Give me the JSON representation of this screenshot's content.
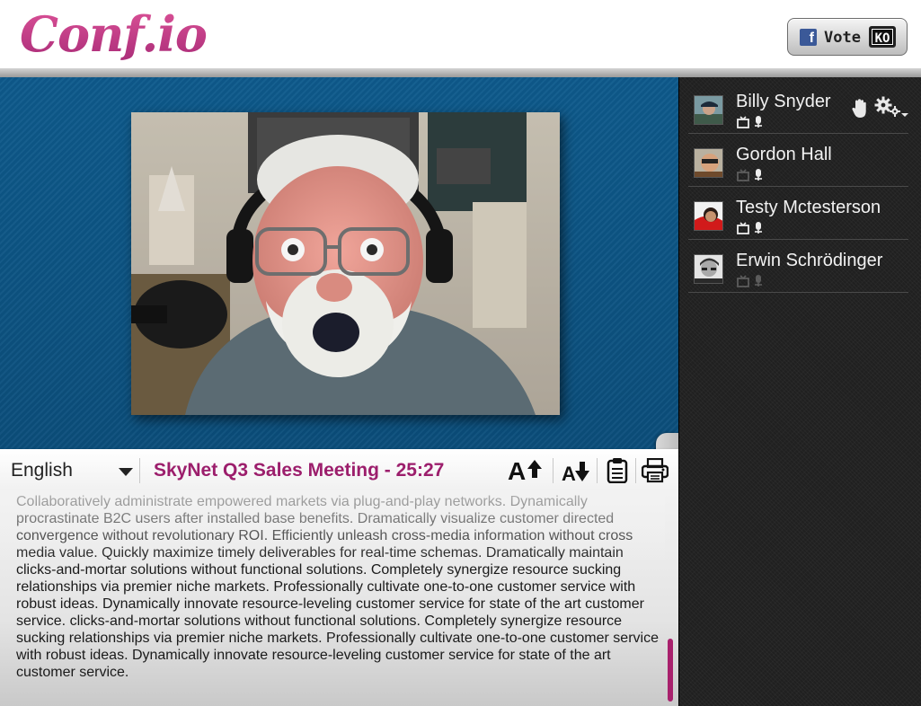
{
  "header": {
    "logo_text": "Conf.io",
    "vote_button": {
      "brand_icon": "facebook-icon",
      "label": "Vote",
      "badge": "KO"
    }
  },
  "video": {
    "collapse_icon": "chevron-right-icon"
  },
  "toolbar": {
    "language": "English",
    "meeting_title": "SkyNet Q3 Sales Meeting - 25:27",
    "icons": [
      "increase-font-icon",
      "decrease-font-icon",
      "clipboard-icon",
      "print-icon"
    ]
  },
  "transcript": {
    "text": "Collaboratively administrate empowered markets via plug-and-play networks. Dynamically procrastinate B2C users after installed base benefits. Dramatically visualize customer directed convergence without revolutionary ROI. Efficiently unleash cross-media information without cross media value. Quickly maximize timely deliverables for real-time schemas. Dramatically maintain clicks-and-mortar solutions without functional solutions. Completely synergize resource sucking relationships via premier niche markets. Professionally cultivate one-to-one customer service with robust ideas. Dynamically innovate resource-leveling customer service for state of the art customer service. clicks-and-mortar solutions without functional solutions. Completely synergize resource sucking relationships via premier niche markets. Professionally cultivate one-to-one customer service with robust ideas. Dynamically innovate resource-leveling customer service for state of the art customer service.",
    "accent_color": "#a8206c"
  },
  "participants": [
    {
      "name": "Billy Snyder",
      "video_on": true,
      "mic_on": true,
      "is_self": true
    },
    {
      "name": "Gordon Hall",
      "video_on": false,
      "mic_on": true,
      "is_self": false
    },
    {
      "name": "Testy Mctesterson",
      "video_on": true,
      "mic_on": true,
      "is_self": false
    },
    {
      "name": "Erwin Schrödinger",
      "video_on": false,
      "mic_on": false,
      "is_self": false
    }
  ],
  "colors": {
    "brand": "#b8337f",
    "title": "#9c1e6c",
    "video_bg": "#0d5687",
    "sidebar_bg": "#232323"
  }
}
